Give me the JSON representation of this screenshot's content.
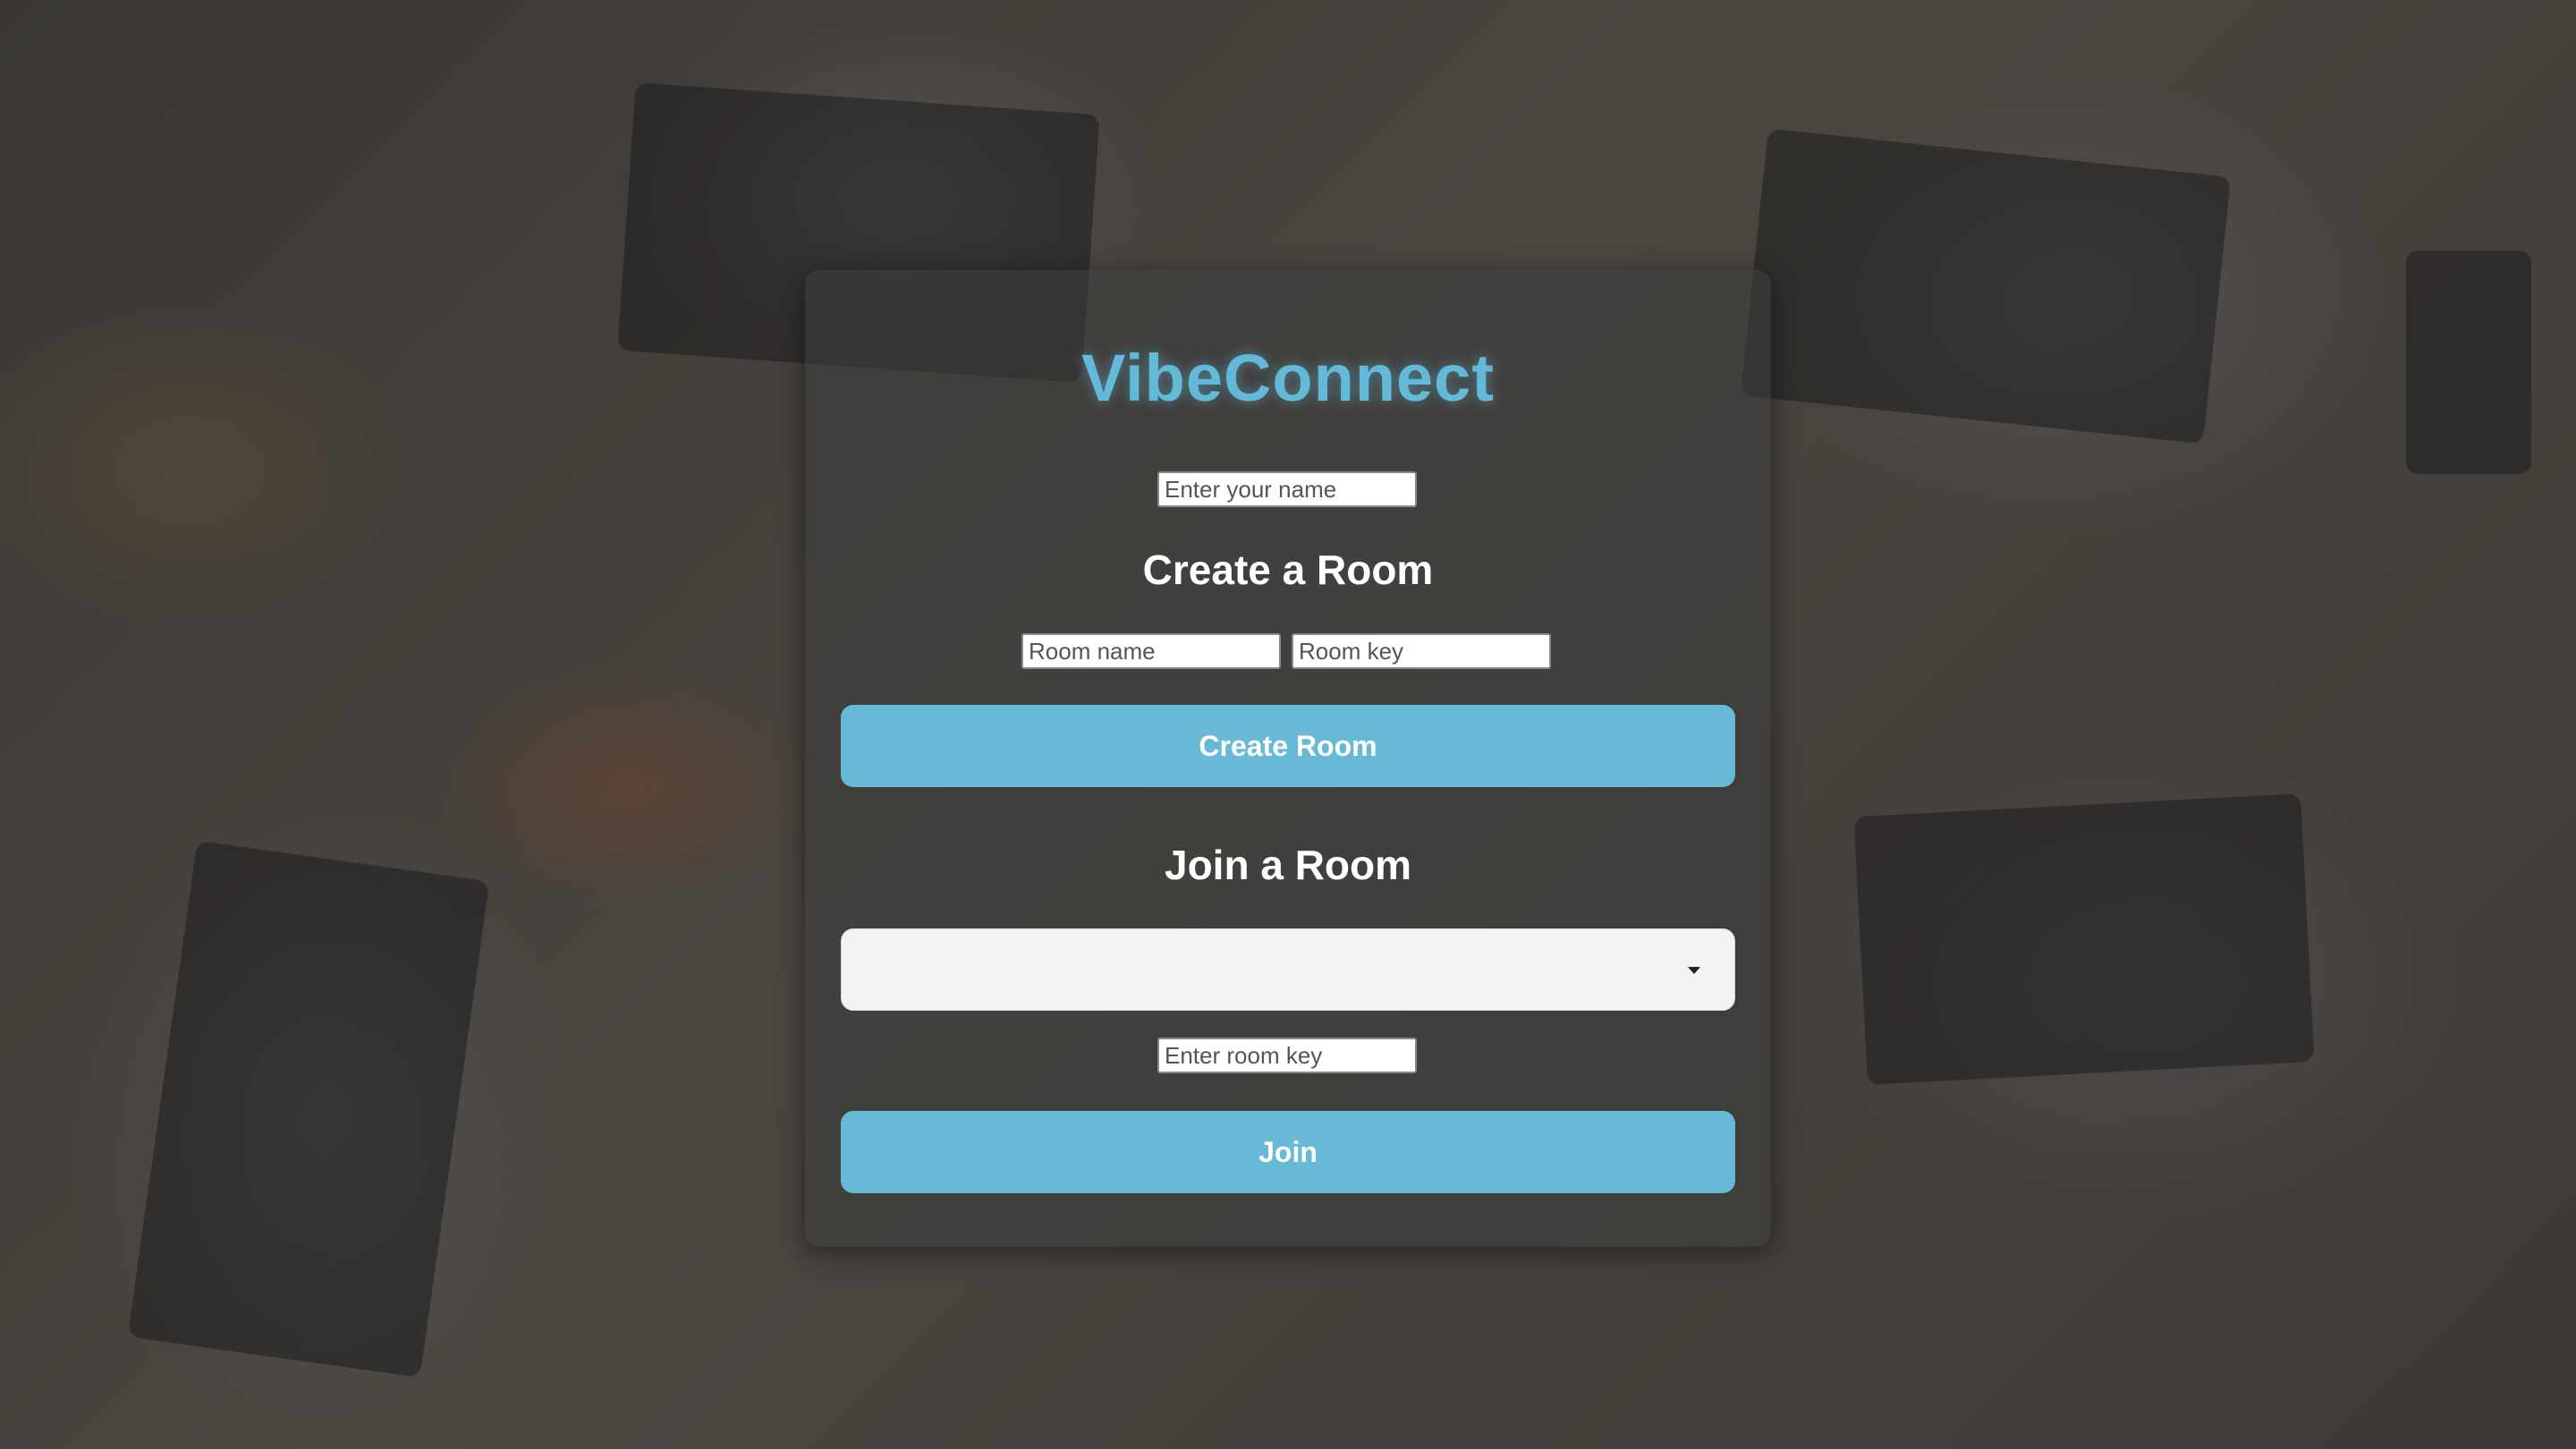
{
  "app": {
    "title": "VibeConnect"
  },
  "name_field": {
    "placeholder": "Enter your name",
    "value": ""
  },
  "create_section": {
    "heading": "Create a Room",
    "room_name_placeholder": "Room name",
    "room_key_placeholder": "Room key",
    "button_label": "Create Room"
  },
  "join_section": {
    "heading": "Join a Room",
    "room_select_value": "",
    "room_key_placeholder": "Enter room key",
    "button_label": "Join"
  },
  "colors": {
    "accent": "#67b9d6",
    "title": "#63b9d8",
    "panel": "rgba(60,60,60,0.55)"
  }
}
